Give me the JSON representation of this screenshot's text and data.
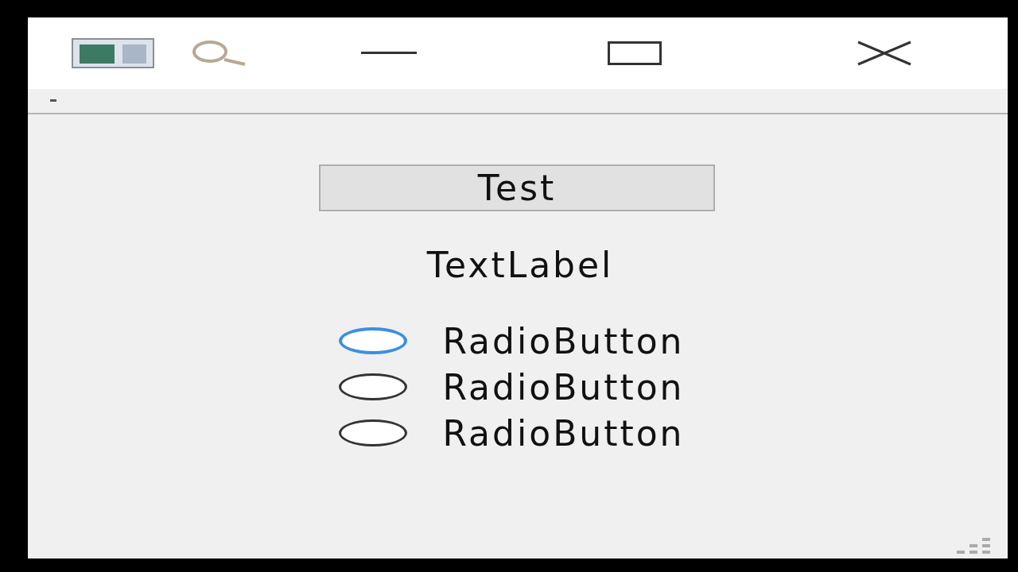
{
  "button": {
    "label": "Test"
  },
  "label": "TextLabel",
  "radios": [
    {
      "label": "RadioButton",
      "selected": false,
      "focused": true
    },
    {
      "label": "RadioButton",
      "selected": false,
      "focused": false
    },
    {
      "label": "RadioButton",
      "selected": false,
      "focused": false
    }
  ]
}
